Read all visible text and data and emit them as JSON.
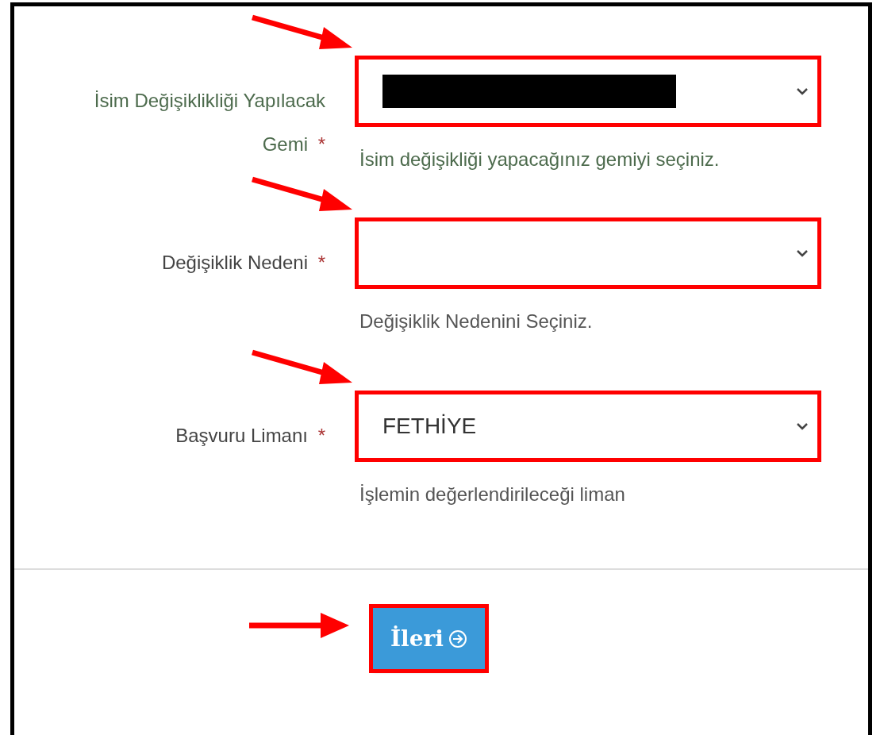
{
  "fields": [
    {
      "label": "İsim Değişiklikliği Yapılacak Gemi",
      "required_mark": "*",
      "valid": true,
      "redacted": true,
      "help": "İsim değişikliği yapacağınız gemiyi seçiniz.",
      "annotated": true
    },
    {
      "label": "Değişiklik Nedeni",
      "required_mark": "*",
      "valid": false,
      "redacted": false,
      "help": "Değişiklik Nedenini Seçiniz.",
      "annotated": true
    },
    {
      "label": "Başvuru Limanı",
      "required_mark": "*",
      "valid": false,
      "redacted": false,
      "value": "FETHİYE",
      "help": "İşlemin değerlendirileceği liman",
      "annotated": true
    }
  ],
  "next_button": {
    "label": "İleri",
    "annotated": true
  }
}
